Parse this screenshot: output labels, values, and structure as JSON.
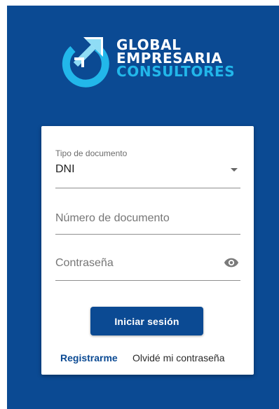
{
  "brand": {
    "line1": "GLOBAL",
    "line2": "EMPRESARIA",
    "line3": "CONSULTORES",
    "colors": {
      "background": "#0b4a93",
      "accent_cyan": "#22b7ea",
      "logo_arrow": "#8fdcf5",
      "white": "#ffffff"
    }
  },
  "form": {
    "doc_type": {
      "label": "Tipo de documento",
      "value": "DNI"
    },
    "doc_number": {
      "placeholder": "Número de documento",
      "value": ""
    },
    "password": {
      "placeholder": "Contraseña",
      "value": "",
      "toggle_icon": "eye-icon"
    },
    "submit_label": "Iniciar sesión",
    "register_link": "Registrarme",
    "forgot_link": "Olvidé mi contraseña"
  }
}
